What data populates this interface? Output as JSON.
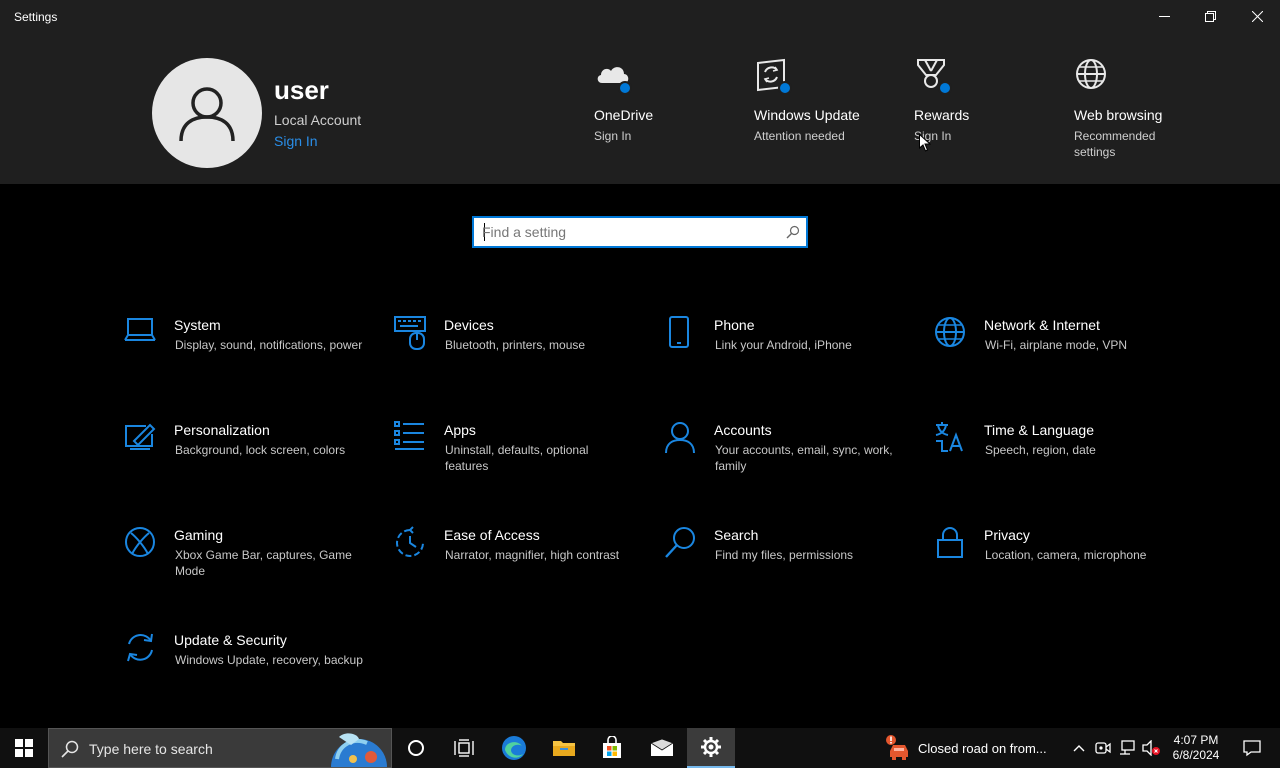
{
  "window": {
    "title": "Settings"
  },
  "header": {
    "user": {
      "name": "user",
      "account_type": "Local Account",
      "sign_in": "Sign In"
    },
    "quick_links": [
      {
        "title": "OneDrive",
        "subtitle": "Sign In",
        "icon": "onedrive-cloud-icon",
        "badge": true
      },
      {
        "title": "Windows Update",
        "subtitle": "Attention needed",
        "icon": "windows-update-icon",
        "badge": true
      },
      {
        "title": "Rewards",
        "subtitle": "Sign In",
        "icon": "rewards-trophy-icon",
        "badge": true
      },
      {
        "title": "Web browsing",
        "subtitle": "Recommended settings",
        "icon": "globe-icon",
        "badge": false
      }
    ]
  },
  "search": {
    "placeholder": "Find a setting",
    "value": ""
  },
  "categories": [
    {
      "title": "System",
      "subtitle": "Display, sound, notifications, power",
      "icon": "laptop-icon"
    },
    {
      "title": "Devices",
      "subtitle": "Bluetooth, printers, mouse",
      "icon": "devices-keyboard-icon"
    },
    {
      "title": "Phone",
      "subtitle": "Link your Android, iPhone",
      "icon": "phone-icon"
    },
    {
      "title": "Network & Internet",
      "subtitle": "Wi-Fi, airplane mode, VPN",
      "icon": "globe-icon"
    },
    {
      "title": "Personalization",
      "subtitle": "Background, lock screen, colors",
      "icon": "paint-pen-icon"
    },
    {
      "title": "Apps",
      "subtitle": "Uninstall, defaults, optional features",
      "icon": "apps-list-icon"
    },
    {
      "title": "Accounts",
      "subtitle": "Your accounts, email, sync, work, family",
      "icon": "person-icon"
    },
    {
      "title": "Time & Language",
      "subtitle": "Speech, region, date",
      "icon": "language-icon"
    },
    {
      "title": "Gaming",
      "subtitle": "Xbox Game Bar, captures, Game Mode",
      "icon": "xbox-icon"
    },
    {
      "title": "Ease of Access",
      "subtitle": "Narrator, magnifier, high contrast",
      "icon": "ease-of-access-icon"
    },
    {
      "title": "Search",
      "subtitle": "Find my files, permissions",
      "icon": "search-icon"
    },
    {
      "title": "Privacy",
      "subtitle": "Location, camera, microphone",
      "icon": "lock-icon"
    },
    {
      "title": "Update & Security",
      "subtitle": "Windows Update, recovery, backup",
      "icon": "sync-arrows-icon"
    }
  ],
  "taskbar": {
    "search_placeholder": "Type here to search",
    "news": "Closed road on from...",
    "time": "4:07 PM",
    "date": "6/8/2024"
  },
  "colors": {
    "accent": "#0078d7",
    "link": "#2a8ee8",
    "header_bg": "#1f1f1f",
    "body_bg": "#000000"
  }
}
